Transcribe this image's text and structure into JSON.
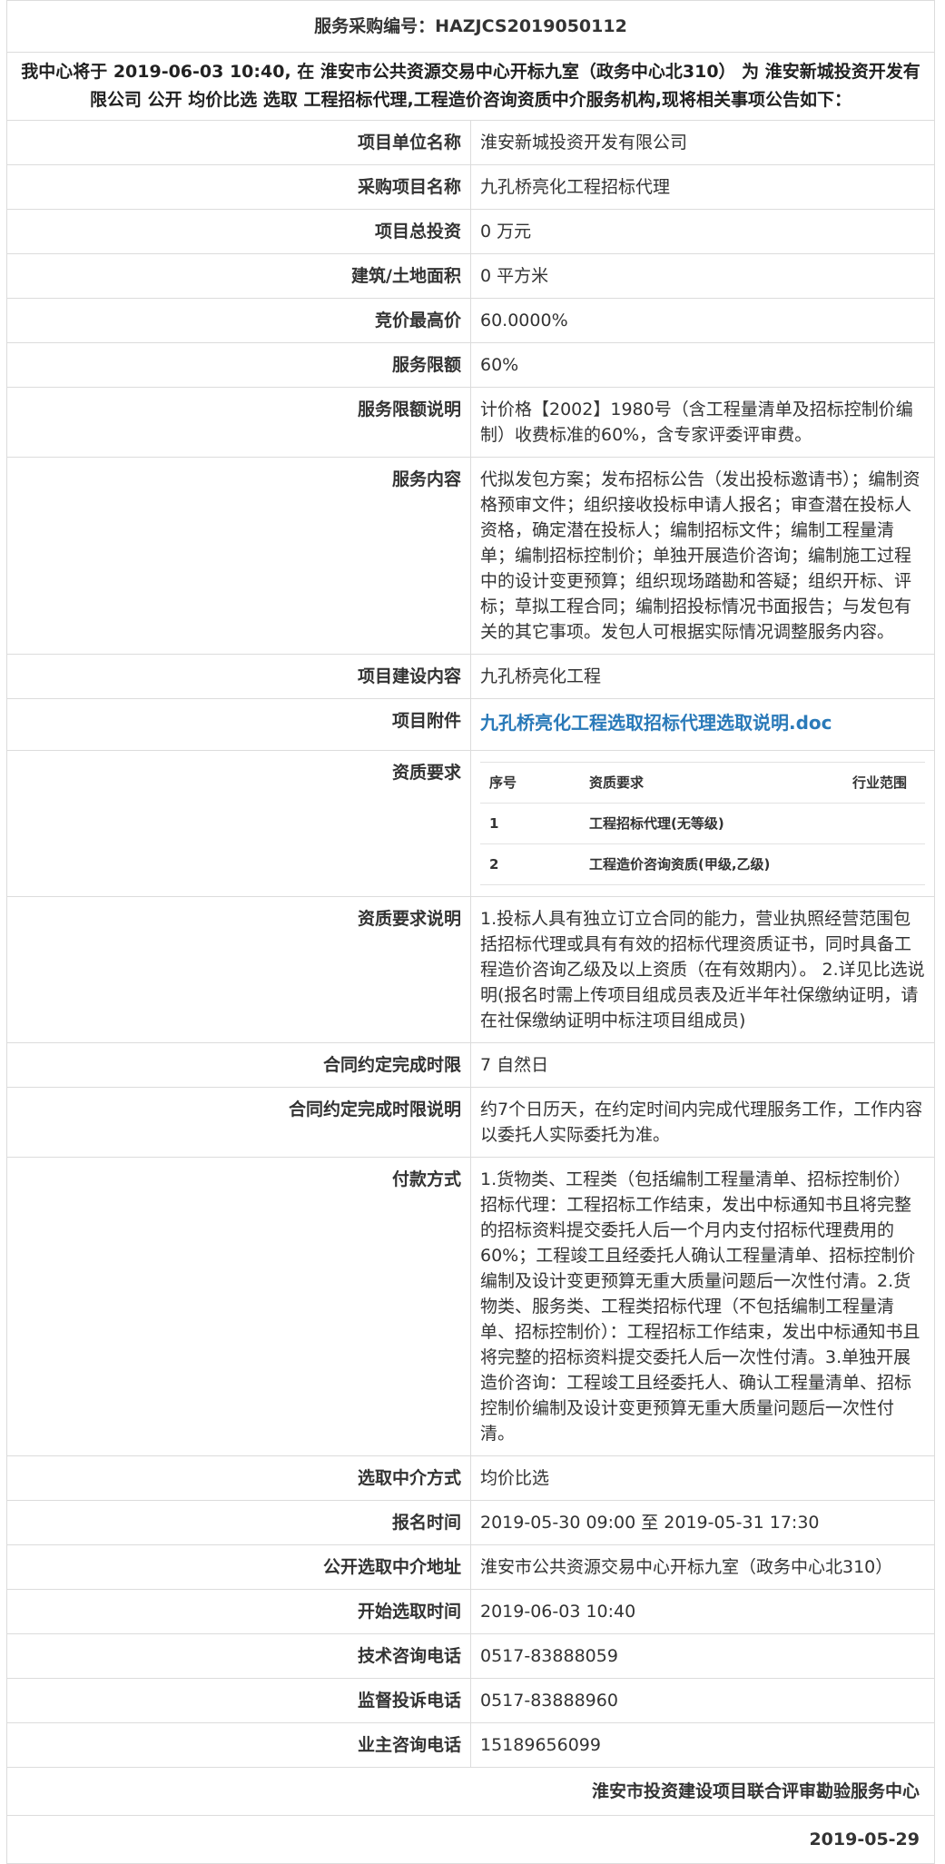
{
  "header": {
    "code_line": "服务采购编号：HAZJCS2019050112"
  },
  "intro": "我中心将于 2019-06-03 10:40, 在 淮安市公共资源交易中心开标九室（政务中心北310） 为 淮安新城投资开发有限公司 公开 均价比选 选取 工程招标代理,工程造价咨询资质中介服务机构,现将相关事项公告如下：",
  "rows": {
    "unit": {
      "label": "项目单位名称",
      "value": "淮安新城投资开发有限公司"
    },
    "name": {
      "label": "采购项目名称",
      "value": "九孔桥亮化工程招标代理"
    },
    "invest": {
      "label": "项目总投资",
      "value": "0 万元"
    },
    "area": {
      "label": "建筑/土地面积",
      "value": "0 平方米"
    },
    "maxprice": {
      "label": "竞价最高价",
      "value": "60.0000%"
    },
    "limit": {
      "label": "服务限额",
      "value": "60%"
    },
    "limit_desc": {
      "label": "服务限额说明",
      "value": "计价格【2002】1980号（含工程量清单及招标控制价编制）收费标准的60%，含专家评委评审费。"
    },
    "content": {
      "label": "服务内容",
      "value": "代拟发包方案；发布招标公告（发出投标邀请书）；编制资格预审文件；组织接收投标申请人报名；审查潜在投标人资格，确定潜在投标人；编制招标文件；编制工程量清单；编制招标控制价；单独开展造价咨询；编制施工过程中的设计变更预算；组织现场踏勘和答疑；组织开标、评标；草拟工程合同；编制招投标情况书面报告；与发包有关的其它事项。发包人可根据实际情况调整服务内容。"
    },
    "build": {
      "label": "项目建设内容",
      "value": "九孔桥亮化工程"
    },
    "attach": {
      "label": "项目附件",
      "value": "九孔桥亮化工程选取招标代理选取说明.doc"
    },
    "qual": {
      "label": "资质要求"
    },
    "qual_desc": {
      "label": "资质要求说明",
      "value": "1.投标人具有独立订立合同的能力，营业执照经营范围包括招标代理或具有有效的招标代理资质证书，同时具备工程造价咨询乙级及以上资质（在有效期内）。 2.详见比选说明(报名时需上传项目组成员表及近半年社保缴纳证明，请在社保缴纳证明中标注项目组成员)"
    },
    "period": {
      "label": "合同约定完成时限",
      "value": "7 自然日"
    },
    "period_desc": {
      "label": "合同约定完成时限说明",
      "value": "约7个日历天，在约定时间内完成代理服务工作，工作内容以委托人实际委托为准。"
    },
    "payment": {
      "label": "付款方式",
      "value": "1.货物类、工程类（包括编制工程量清单、招标控制价）招标代理：工程招标工作结束，发出中标通知书且将完整的招标资料提交委托人后一个月内支付招标代理费用的60%；工程竣工且经委托人确认工程量清单、招标控制价编制及设计变更预算无重大质量问题后一次性付清。2.货物类、服务类、工程类招标代理（不包括编制工程量清单、招标控制价）：工程招标工作结束，发出中标通知书且将完整的招标资料提交委托人后一次性付清。3.单独开展造价咨询：工程竣工且经委托人、确认工程量清单、招标控制价编制及设计变更预算无重大质量问题后一次性付清。"
    },
    "method": {
      "label": "选取中介方式",
      "value": "均价比选"
    },
    "signup": {
      "label": "报名时间",
      "value": "2019-05-30 09:00 至 2019-05-31 17:30"
    },
    "address": {
      "label": "公开选取中介地址",
      "value": "淮安市公共资源交易中心开标九室（政务中心北310）"
    },
    "start": {
      "label": "开始选取时间",
      "value": "2019-06-03 10:40"
    },
    "tech_tel": {
      "label": "技术咨询电话",
      "value": "0517-83888059"
    },
    "super_tel": {
      "label": "监督投诉电话",
      "value": "0517-83888960"
    },
    "owner_tel": {
      "label": "业主咨询电话",
      "value": "15189656099"
    }
  },
  "qual_table": {
    "headers": [
      "序号",
      "资质要求",
      "行业范围"
    ],
    "rows": [
      [
        "1",
        "工程招标代理(无等级)",
        ""
      ],
      [
        "2",
        "工程造价咨询资质(甲级,乙级)",
        ""
      ]
    ]
  },
  "footer": {
    "org": "淮安市投资建设项目联合评审勘验服务中心",
    "date": "2019-05-29"
  }
}
